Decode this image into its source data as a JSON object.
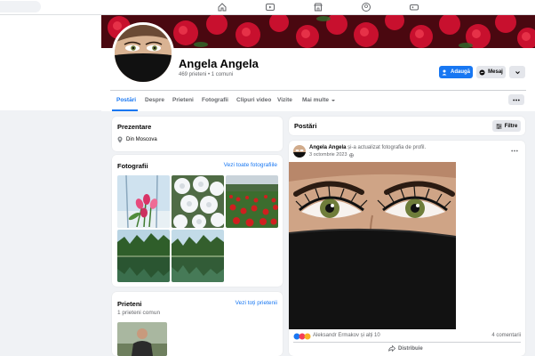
{
  "profile": {
    "name": "Angela Angela",
    "stats": "469 prieteni • 1 comuni",
    "add_label": "Adaugă",
    "message_label": "Mesaj"
  },
  "tabs": [
    "Postări",
    "Despre",
    "Prieteni",
    "Fotografii",
    "Clipuri video",
    "Vizite",
    "Mai multe"
  ],
  "intro": {
    "title": "Prezentare",
    "location": "Din Moscova"
  },
  "photos_card": {
    "title": "Fotografii",
    "link": "Vezi toate fotografiile"
  },
  "friends_card": {
    "title": "Prieteni",
    "link": "Vezi toți prietenii",
    "subtitle": "1 prieteni comun"
  },
  "posts_header": {
    "title": "Postări",
    "filter_label": "Filtre"
  },
  "post": {
    "author": "Angela Angela",
    "action": "și-a actualizat fotografia de profil.",
    "date": "3 octombrie 2023",
    "reactions": "Aleksandr Ermakov și alți 10",
    "comments": "4 comentarii",
    "share_label": "Distribuie"
  },
  "colors": {
    "accent": "#1877f2",
    "background": "#f0f2f5",
    "muted": "#65676b"
  }
}
